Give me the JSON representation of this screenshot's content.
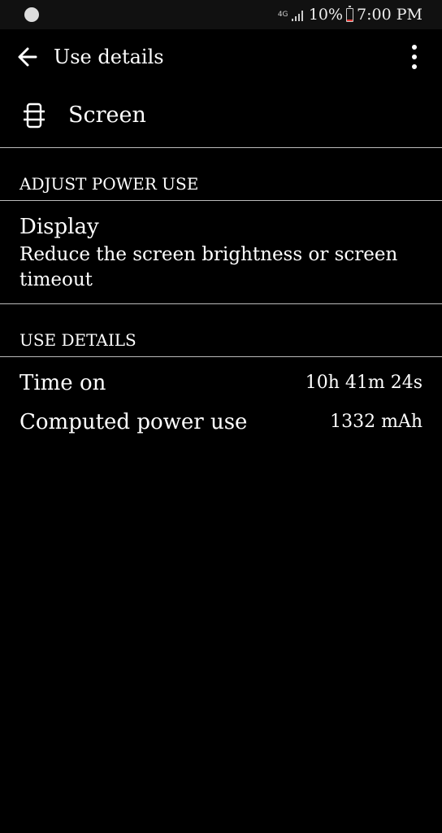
{
  "status_bar": {
    "battery_percent": "10%",
    "time": "7:00 PM",
    "network_type": "4G",
    "battery_level": 0.1,
    "battery_low_color": "#e53935",
    "icons": [
      "notification-icon",
      "network-4g-icon",
      "signal-icon",
      "battery-icon"
    ]
  },
  "app_bar": {
    "title": "Use details",
    "back_icon": "arrow-back-icon",
    "more_icon": "more-vert-icon"
  },
  "header": {
    "icon": "screen-icon",
    "label": "Screen"
  },
  "adjust_section": {
    "title": "ADJUST POWER USE",
    "item": {
      "title": "Display",
      "summary": "Reduce the screen brightness or screen timeout"
    }
  },
  "details_section": {
    "title": "USE DETAILS",
    "rows": [
      {
        "label": "Time on",
        "value": "10h 41m 24s"
      },
      {
        "label": "Computed power use",
        "value": "1332 mAh"
      }
    ]
  },
  "colors": {
    "background": "#000000",
    "status_bar_bg": "#111111",
    "text": "#ffffff",
    "divider": "#bbbbbb"
  }
}
